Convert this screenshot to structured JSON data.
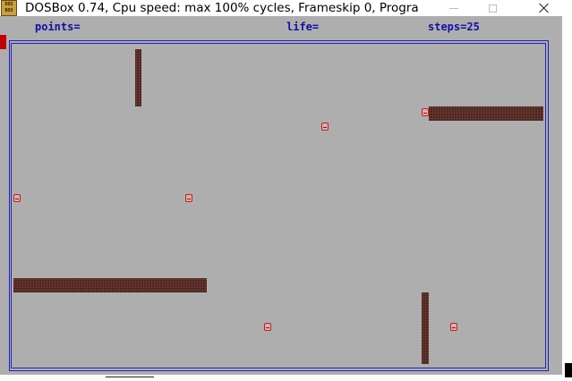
{
  "window": {
    "title": "DOSBox 0.74, Cpu speed: max 100% cycles, Frameskip  0, Progra...",
    "icon_line1": "DOS",
    "icon_line2": "BOX",
    "icon": "dosbox-icon",
    "controls": [
      "minimize-icon",
      "maximize-icon",
      "close-icon"
    ]
  },
  "hud": {
    "points_label": "points=",
    "points_value": "",
    "life_label": "life=",
    "life_value": "",
    "steps_label": "steps=",
    "steps_value": "25"
  },
  "colors": {
    "playfield": "#aeaeae",
    "border": "#2020c0",
    "hud_text": "#1010a8",
    "wall": "#4a2a22",
    "food": "#c02020",
    "cursor": "#c00000"
  },
  "game": {
    "walls": [
      "wall-vertical-top-left",
      "wall-horizontal-right",
      "wall-horizontal-bottom-left",
      "wall-vertical-bottom-right"
    ],
    "food_count": 6
  }
}
